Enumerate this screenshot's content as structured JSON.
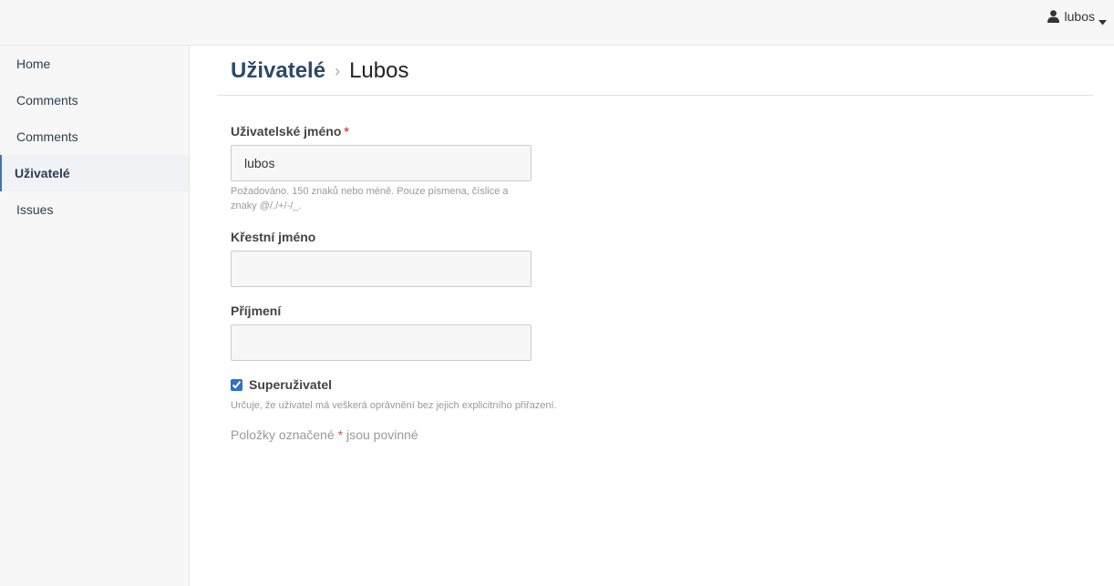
{
  "header": {
    "user_name": "lubos",
    "user_icon": "user-icon",
    "caret_icon": "caret-down-icon"
  },
  "sidebar": {
    "items": [
      {
        "label": "Home"
      },
      {
        "label": "Comments"
      },
      {
        "label": "Comments"
      },
      {
        "label": "Uživatelé",
        "active": true
      },
      {
        "label": "Issues"
      }
    ]
  },
  "breadcrumb": {
    "parent": "Uživatelé",
    "separator": "›",
    "current": "Lubos"
  },
  "form": {
    "username": {
      "label": "Uživatelské jméno",
      "required_mark": "*",
      "value": "lubos",
      "help": "Požadováno. 150 znaků nebo méně. Pouze písmena, číslice a znaky @/./+/-/_."
    },
    "first_name": {
      "label": "Křestní jméno",
      "value": ""
    },
    "last_name": {
      "label": "Příjmení",
      "value": ""
    },
    "superuser": {
      "label": "Superuživatel",
      "checked": true,
      "help": "Určuje, že uživatel má veškerá oprávnění bez jejich explicitního přiřazení."
    },
    "required_note": {
      "prefix": "Položky označené",
      "mark": "*",
      "suffix": "jsou povinné"
    }
  },
  "colors": {
    "accent": "#3b73b9",
    "breadcrumb_link": "#2d4a66",
    "required": "#d9534f"
  }
}
